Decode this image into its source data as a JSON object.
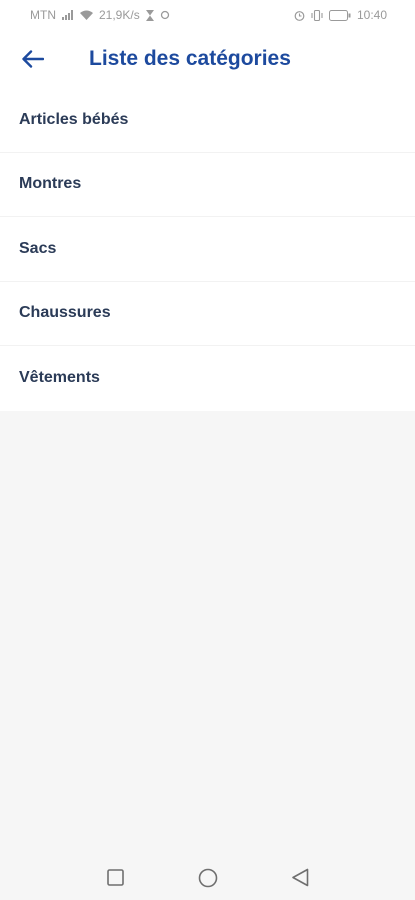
{
  "status_bar": {
    "carrier": "MTN",
    "network_speed": "21,9K/s",
    "time": "10:40",
    "battery_level": "24",
    "icons": [
      "signal-icon",
      "wifi-icon",
      "hourglass-icon",
      "sync-icon",
      "alarm-icon",
      "vibrate-icon",
      "battery-icon"
    ]
  },
  "header": {
    "title": "Liste des catégories",
    "back_icon": "arrow-left-icon"
  },
  "categories": [
    {
      "label": "Articles bébés"
    },
    {
      "label": "Montres"
    },
    {
      "label": "Sacs"
    },
    {
      "label": "Chaussures"
    },
    {
      "label": "Vêtements"
    }
  ],
  "nav_bar": {
    "icons": [
      "square-recent-icon",
      "circle-home-icon",
      "triangle-back-icon"
    ]
  },
  "colors": {
    "accent": "#1d4a9e",
    "item_text": "#2b3b57",
    "background": "#f6f6f6",
    "surface": "#ffffff"
  }
}
